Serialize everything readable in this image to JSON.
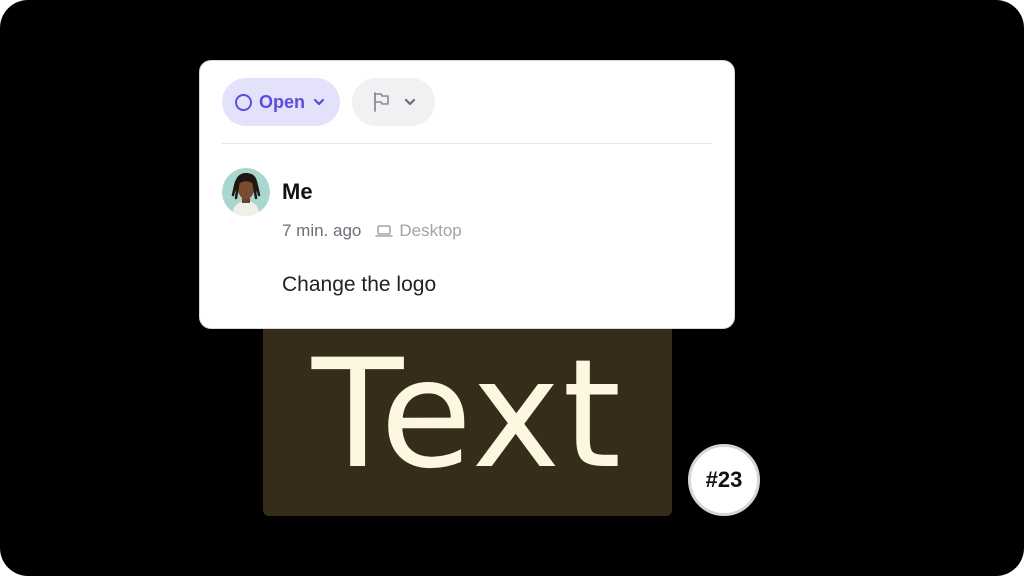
{
  "canvas": {
    "element_label": "Text",
    "issue_badge": "#23"
  },
  "comment_card": {
    "status": {
      "label": "Open",
      "icon": "circle-icon",
      "accent_color": "#5a4ee0",
      "background_color": "#e4e2fb"
    },
    "priority": {
      "icon": "flag-icon"
    },
    "author": {
      "name": "Me",
      "avatar": "avatar"
    },
    "meta": {
      "timestamp": "7 min. ago",
      "device": "Desktop",
      "device_icon": "laptop-icon"
    },
    "body": "Change the logo"
  }
}
